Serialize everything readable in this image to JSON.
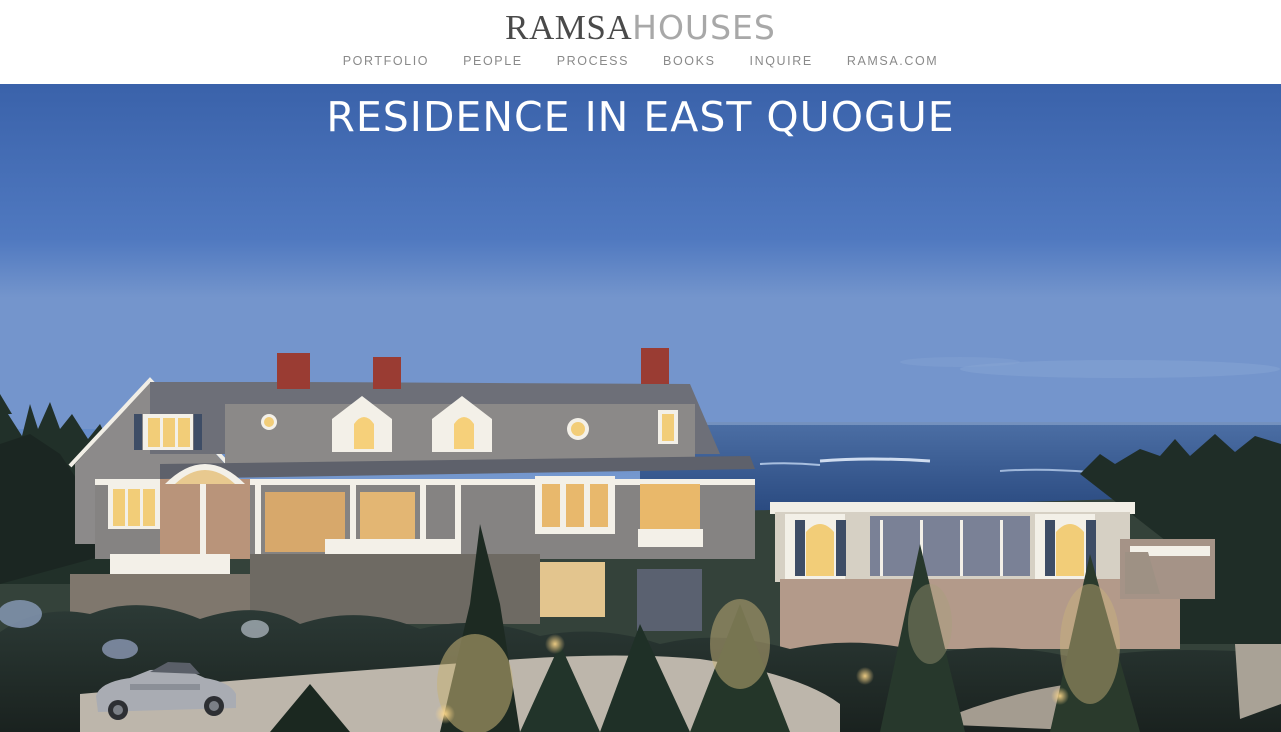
{
  "header": {
    "logo_bold": "RAMSA",
    "logo_light": "HOUSES",
    "nav": [
      {
        "label": "PORTFOLIO"
      },
      {
        "label": "PEOPLE"
      },
      {
        "label": "PROCESS"
      },
      {
        "label": "BOOKS"
      },
      {
        "label": "INQUIRE"
      },
      {
        "label": "RAMSA.COM"
      }
    ]
  },
  "hero": {
    "title": "RESIDENCE IN EAST QUOGUE"
  },
  "colors": {
    "logo_dark": "#4a4a4a",
    "logo_light": "#a8a8a8",
    "nav_text": "#8a8a8a",
    "sky": "#4a73bb",
    "ocean": "#2f5286",
    "shingle": "#8e8c8c",
    "trim": "#f4f1ea",
    "chimney": "#9b3d33",
    "lit_window": "#f7d37c"
  }
}
